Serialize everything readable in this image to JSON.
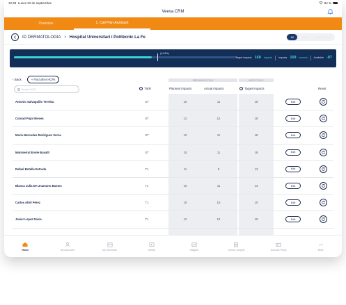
{
  "status": {
    "time": "12:49",
    "date": "Lunes 22 de septiembre",
    "battery": "84 %"
  },
  "app": {
    "title": "Veeva CRM"
  },
  "tabs": [
    {
      "label": "Overview",
      "active": false
    },
    {
      "label": "1. Call Plan Assistant",
      "active": true
    }
  ],
  "breadcrumb": {
    "first": "ID DERMATOLOGIA",
    "second": "Hospital Universitari i Politècnic La Fe"
  },
  "filter": {
    "all": "All",
    "opt1": "······",
    "opt2": "··········· ····"
  },
  "progress": {
    "fill_fraction": 0.62,
    "marker_label": "(14.8%)",
    "target_label": "Target impacts",
    "target_value": "168",
    "target_unit": "impacts",
    "impacts_label": "Impacts",
    "impacts_value": "168",
    "impacts_unit": "impacts",
    "available_label": "Available",
    "available_value": "-87"
  },
  "actions": {
    "back": "Back",
    "find": "+ Find other HCPs"
  },
  "table": {
    "search_placeholder": "Search HCP",
    "previous_cycle": "PREVIOUS CYCLE",
    "next_cycle": "NEXT CYCLE",
    "headers": {
      "tier": "TIER",
      "planned": "Planned impacts",
      "actual": "Actual impacts",
      "target": "Target impacts",
      "reset": "Reset"
    },
    "edit_label": "Edit",
    "rows": [
      {
        "name": "Antonio Salvaguillo Terreba",
        "tier": "ST",
        "planned": "10",
        "actual": "11",
        "target": "18"
      },
      {
        "name": "Conrad Pujol Nieves",
        "tier": "ST",
        "planned": "12",
        "actual": "12",
        "target": "18"
      },
      {
        "name": "María Mercedes Rodríguez Serna",
        "tier": "ST",
        "planned": "10",
        "actual": "11",
        "target": "18"
      },
      {
        "name": "Montserrat Evole Busalli",
        "tier": "ST",
        "planned": "10",
        "actual": "11",
        "target": "18"
      },
      {
        "name": "Rafael Botella Estrada",
        "tier": "T1",
        "planned": "11",
        "actual": "9",
        "target": "13"
      },
      {
        "name": "Blanca Julia De Unamuno Bustos",
        "tier": "T1",
        "planned": "10",
        "actual": "11",
        "target": "13"
      },
      {
        "name": "Carlos Abril Pérez",
        "tier": "T1",
        "planned": "10",
        "actual": "10",
        "target": "10"
      },
      {
        "name": "Javier Lopez Davia",
        "tier": "T1",
        "planned": "12",
        "actual": "12",
        "target": "10"
      }
    ]
  },
  "nav": [
    {
      "label": "Home",
      "icon": "home-icon",
      "active": true
    },
    {
      "label": "My Accounts",
      "icon": "person-icon",
      "active": false
    },
    {
      "label": "My Schedule",
      "icon": "calendar-icon",
      "active": false
    },
    {
      "label": "Media",
      "icon": "media-icon",
      "active": false
    },
    {
      "label": "Insights",
      "icon": "insights-icon",
      "active": false
    },
    {
      "label": "Survey Targets",
      "icon": "survey-icon",
      "active": false
    },
    {
      "label": "Account Plans",
      "icon": "account-plans-icon",
      "active": false
    },
    {
      "label": "More",
      "icon": "more-icon",
      "active": false
    }
  ],
  "colors": {
    "accent": "#f08a15",
    "navy": "#132f57",
    "teal": "#40d3d3"
  }
}
